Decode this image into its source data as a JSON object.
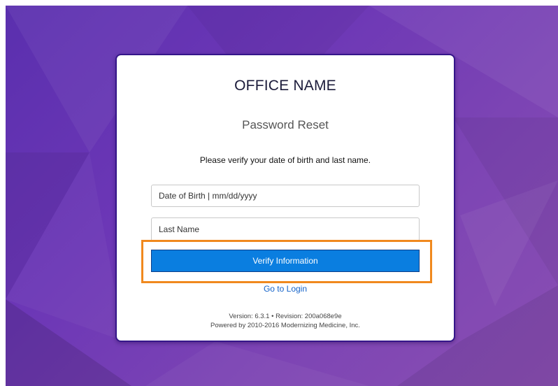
{
  "form": {
    "office_name": "OFFICE NAME",
    "subtitle": "Password Reset",
    "instruction": "Please verify your date of birth and last name.",
    "dob_placeholder": "Date of Birth | mm/dd/yyyy",
    "lastname_placeholder": "Last Name",
    "verify_label": "Verify Information",
    "login_link": "Go to Login"
  },
  "footer": {
    "version_line": "Version: 6.3.1 • Revision: 200a068e9e",
    "powered_line": "Powered by 2010-2016 Modernizing Medicine, Inc."
  },
  "colors": {
    "background_gradient_start": "#5a2fae",
    "background_gradient_end": "#8a4fb2",
    "button": "#0a7ee0",
    "link": "#1463c9",
    "highlight": "#f0891e"
  }
}
